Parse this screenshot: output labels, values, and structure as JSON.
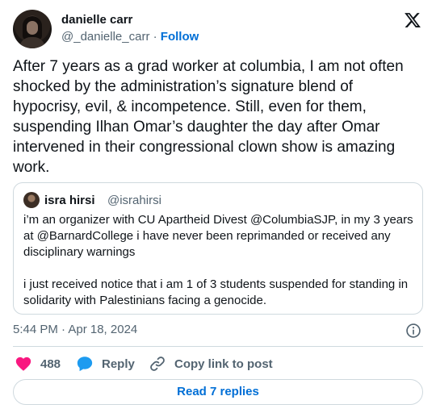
{
  "author": {
    "name": "danielle carr",
    "handle": "@_danielle_carr",
    "separator": "·",
    "follow_label": "Follow"
  },
  "tweet": {
    "text": "After 7 years as a grad worker at columbia, I am not often shocked by the administration’s signature blend of hypocrisy, evil, & incompetence. Still, even for them, suspending Ilhan Omar’s daughter the day after Omar intervened in their congressional clown show is amazing work.",
    "timestamp": "5:44 PM · Apr 18, 2024"
  },
  "quoted": {
    "name": "isra hirsi",
    "handle": "@israhirsi",
    "paragraphs": [
      "i’m an organizer with CU Apartheid Divest @ColumbiaSJP, in my 3 years at @BarnardCollege i have never been reprimanded or received any disciplinary warnings",
      "i just received notice that i am 1 of 3 students suspended for standing in solidarity with Palestinians facing a genocide."
    ]
  },
  "actions": {
    "like_count": "488",
    "reply_label": "Reply",
    "copy_label": "Copy link to post"
  },
  "footer": {
    "read_replies_label": "Read 7 replies"
  },
  "icons": {
    "platform_logo": "x-logo-icon",
    "info": "info-icon",
    "like": "heart-icon",
    "reply": "speech-bubble-icon",
    "copy": "link-icon"
  },
  "colors": {
    "link": "#006fd6",
    "like": "#f91880",
    "reply": "#1d9bf0",
    "muted": "#536471",
    "border": "#cfd9de"
  }
}
